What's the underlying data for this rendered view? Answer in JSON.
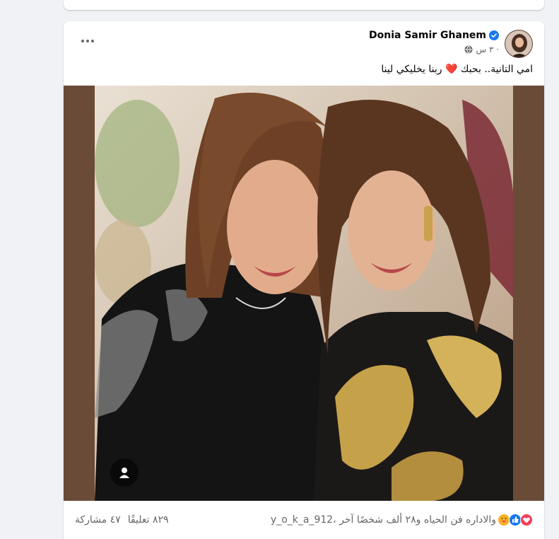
{
  "post": {
    "author_name": "Donia Samir Ghanem",
    "time": "٣ س ·",
    "caption_part1": "امي التانية.. بحبك",
    "caption_heart": "❤️",
    "caption_part2": "ربنا يخليكي لينا",
    "reactions_text": "y_o_k_a_912، والاداره فن الحياه و٢٨ ألف شخصًا آخر",
    "comments_text": "٨٢٩ تعليقًا",
    "shares_text": "٤٧ مشاركة"
  },
  "icons": {
    "verified": "verified-badge-icon",
    "audience": "globe-icon",
    "more": "more-options-icon",
    "tag": "person-tag-icon",
    "reactions": [
      "love-icon",
      "like-icon",
      "care-icon"
    ]
  },
  "colors": {
    "page_bg": "#f0f2f5",
    "card_bg": "#ffffff",
    "verified": "#1877f2",
    "secondary_text": "#65676b",
    "love": "#f33e58",
    "like": "#1877f2",
    "care": "#f7b125",
    "photo_frame": "#6a4b37"
  }
}
